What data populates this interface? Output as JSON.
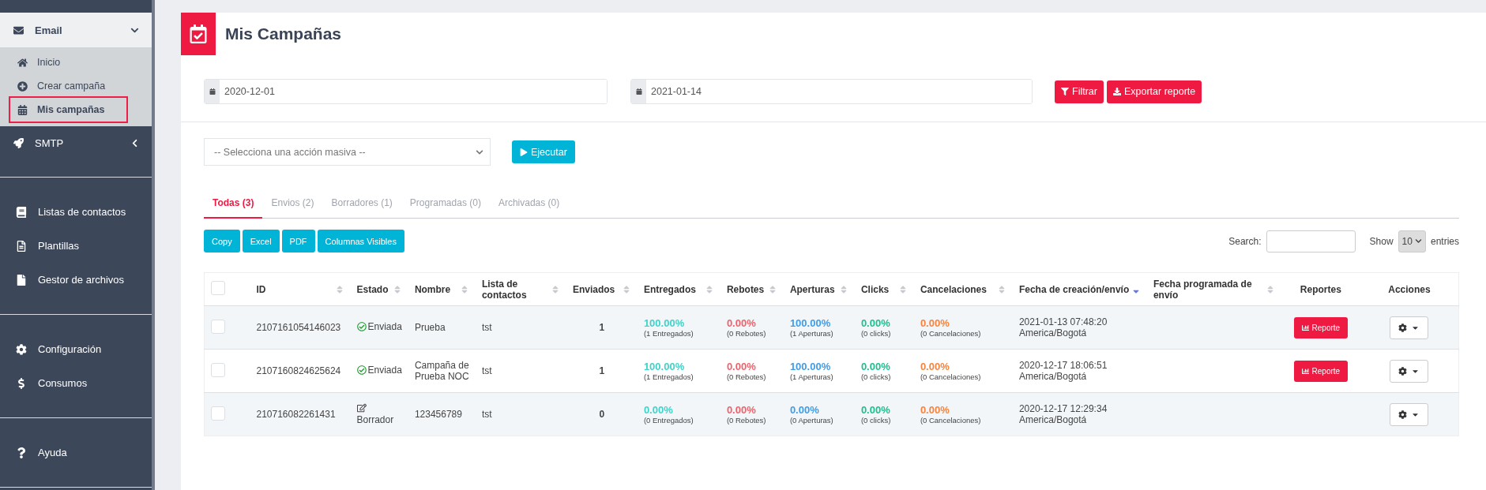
{
  "sidebar": {
    "groups": [
      {
        "items": [
          {
            "label": "Email",
            "expanded": true,
            "children": [
              {
                "label": "Inicio",
                "selected": false
              },
              {
                "label": "Crear campaña",
                "selected": false
              },
              {
                "label": "Mis campañas",
                "selected": true
              }
            ]
          },
          {
            "label": "SMTP",
            "expanded": false
          }
        ]
      },
      {
        "items": [
          {
            "label": "Listas de contactos"
          },
          {
            "label": "Plantillas"
          },
          {
            "label": "Gestor de archivos"
          }
        ]
      },
      {
        "items": [
          {
            "label": "Configuración"
          },
          {
            "label": "Consumos"
          }
        ]
      },
      {
        "items": [
          {
            "label": "Ayuda"
          }
        ]
      }
    ]
  },
  "page": {
    "title": "Mis Campañas"
  },
  "filters": {
    "date_from": "2020-12-01",
    "date_to": "2021-01-14",
    "buttons": [
      "Filtrar",
      "Exportar reporte"
    ]
  },
  "bulk": {
    "placeholder": "-- Selecciona una acción masiva --",
    "button": "Ejecutar"
  },
  "tabs": [
    {
      "label": "Todas (3)",
      "selected": true
    },
    {
      "label": "Envios (2)",
      "selected": false
    },
    {
      "label": "Borradores (1)",
      "selected": false
    },
    {
      "label": "Programadas (0)",
      "selected": false
    },
    {
      "label": "Archivadas (0)",
      "selected": false
    }
  ],
  "export_buttons": [
    "Copy",
    "Excel",
    "PDF",
    "Columnas Visibles"
  ],
  "search": {
    "label": "Search:"
  },
  "page_size": {
    "before": "Show",
    "value": "10",
    "after": "entries"
  },
  "table": {
    "select_all_checked": false,
    "columns": [
      {
        "label": "ID",
        "sorted": false
      },
      {
        "label": "Estado",
        "sorted": false
      },
      {
        "label": "Nombre",
        "sorted": false
      },
      {
        "label": "Lista de contactos",
        "sorted": false
      },
      {
        "label": "Enviados",
        "sorted": false
      },
      {
        "label": "Entregados",
        "sorted": false
      },
      {
        "label": "Rebotes",
        "sorted": false
      },
      {
        "label": "Aperturas",
        "sorted": false
      },
      {
        "label": "Clicks",
        "sorted": false
      },
      {
        "label": "Cancelaciones",
        "sorted": false
      },
      {
        "label": "Fecha de creación/envío",
        "sorted": true
      },
      {
        "label": "Fecha programada de envío",
        "sorted": false
      },
      {
        "label": "Reportes"
      },
      {
        "label": "Acciones"
      }
    ],
    "rows": [
      {
        "checked": false,
        "id": "2107161054146023",
        "status": {
          "kind": "sent",
          "label": "Enviada"
        },
        "name": "Prueba",
        "list": "tst",
        "sent": "1",
        "metrics": [
          {
            "value": "100.00%",
            "detail": "(1 Entregados)"
          },
          {
            "value": "0.00%",
            "detail": "(0 Rebotes)"
          },
          {
            "value": "100.00%",
            "detail": "(1 Aperturas)"
          },
          {
            "value": "0.00%",
            "detail": "(0 clicks)"
          },
          {
            "value": "0.00%",
            "detail": "(0 Cancelaciones)"
          }
        ],
        "created": "2021-01-13 07:48:20",
        "timezone": "America/Bogotá",
        "report": "Reporte"
      },
      {
        "checked": false,
        "id": "2107160824625624",
        "status": {
          "kind": "sent",
          "label": "Enviada"
        },
        "name": "Campaña de Prueba NOC",
        "list": "tst",
        "sent": "1",
        "metrics": [
          {
            "value": "100.00%",
            "detail": "(1 Entregados)"
          },
          {
            "value": "0.00%",
            "detail": "(0 Rebotes)"
          },
          {
            "value": "100.00%",
            "detail": "(1 Aperturas)"
          },
          {
            "value": "0.00%",
            "detail": "(0 clicks)"
          },
          {
            "value": "0.00%",
            "detail": "(0 Cancelaciones)"
          }
        ],
        "created": "2020-12-17 18:06:51",
        "timezone": "America/Bogotá",
        "report": "Reporte"
      },
      {
        "checked": false,
        "id": "210716082261431",
        "status": {
          "kind": "draft",
          "label": "Borrador"
        },
        "name": "123456789",
        "list": "tst",
        "sent": "0",
        "metrics": [
          {
            "value": "0.00%",
            "detail": "(0 Entregados)"
          },
          {
            "value": "0.00%",
            "detail": "(0 Rebotes)"
          },
          {
            "value": "0.00%",
            "detail": "(0 Aperturas)"
          },
          {
            "value": "0.00%",
            "detail": "(0 clicks)"
          },
          {
            "value": "0.00%",
            "detail": "(0 Cancelaciones)"
          }
        ],
        "created": "2020-12-17 12:29:34",
        "timezone": "America/Bogotá"
      }
    ]
  }
}
